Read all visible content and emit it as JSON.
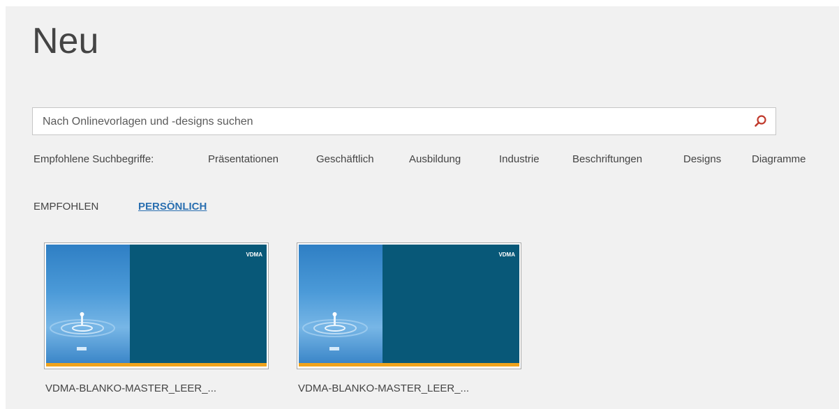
{
  "page": {
    "title": "Neu"
  },
  "search": {
    "placeholder": "Nach Onlinevorlagen und -designs suchen",
    "icon": "search-icon",
    "accent": "#c0392b"
  },
  "suggestions": {
    "label": "Empfohlene Suchbegriffe:",
    "items": [
      "Präsentationen",
      "Geschäftlich",
      "Ausbildung",
      "Industrie",
      "Beschriftungen",
      "Designs",
      "Diagramme"
    ]
  },
  "tabs": {
    "items": [
      {
        "label": "EMPFOHLEN",
        "active": false
      },
      {
        "label": "PERSÖNLICH",
        "active": true
      }
    ]
  },
  "templates": [
    {
      "name": "VDMA-BLANKO-MASTER_LEER_...",
      "logo_text": "VDMA"
    },
    {
      "name": "VDMA-BLANKO-MASTER_LEER_...",
      "logo_text": "VDMA"
    }
  ],
  "colors": {
    "active_tab": "#2a6fb0",
    "thumb_dark": "#085878",
    "thumb_bar": "#f0a31c"
  }
}
